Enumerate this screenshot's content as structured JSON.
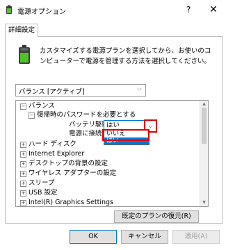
{
  "window": {
    "title": "電源オプション",
    "help_label": "?",
    "close_label": "✕"
  },
  "tab": {
    "label": "詳細設定"
  },
  "description": "カスタマイズする電源プランを選択してから、お使いのコンピューターで電源を管理する方法を選択してください。",
  "plan_select": {
    "value": "バランス [アクティブ]"
  },
  "tree": {
    "items": [
      {
        "label": "バランス",
        "expander": "⊟"
      },
      {
        "label": "復帰時のパスワードを必要とする",
        "expander": "⊟"
      },
      {
        "label": "バッテリ駆動:"
      },
      {
        "label": "電源に接続:"
      },
      {
        "label": "ハード ディスク",
        "expander": "⊞"
      },
      {
        "label": "Internet Explorer",
        "expander": "⊞"
      },
      {
        "label": "デスクトップの背景の設定",
        "expander": "⊞"
      },
      {
        "label": "ワイヤレス アダプターの設定",
        "expander": "⊞"
      },
      {
        "label": "スリープ",
        "expander": "⊞"
      },
      {
        "label": "USB 設定",
        "expander": "⊞"
      },
      {
        "label": "Intel(R) Graphics Settings",
        "expander": "⊞"
      }
    ],
    "battery_combo": {
      "value": "はい"
    },
    "dropdown_options": [
      "いいえ",
      "はい"
    ]
  },
  "restore_button": "既定のプランの復元(R)",
  "buttons": {
    "ok": "OK",
    "cancel": "キャンセル",
    "apply": "適用(A)"
  },
  "colors": {
    "accent": "#0078d7",
    "highlight_red": "#e00000"
  }
}
